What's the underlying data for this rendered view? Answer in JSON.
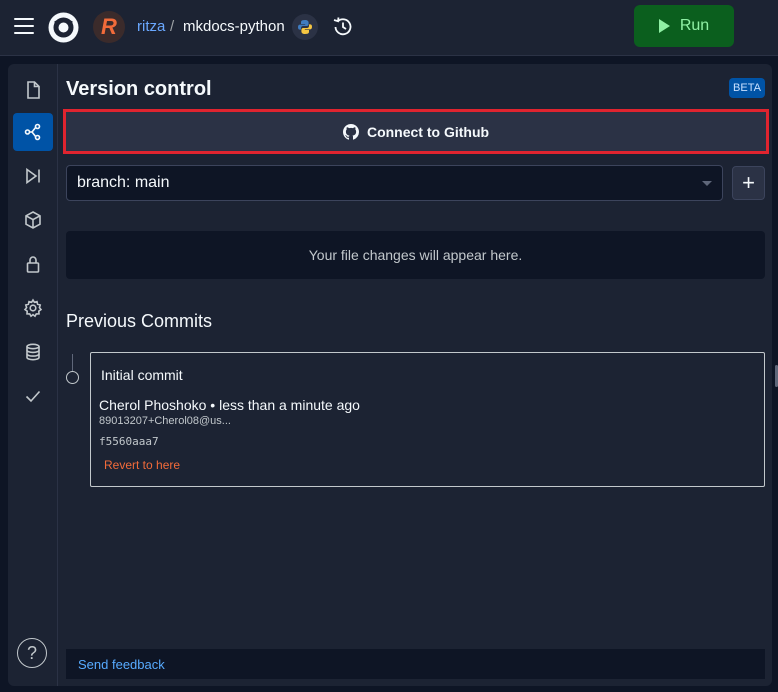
{
  "topbar": {
    "user": "ritza",
    "separator": "/",
    "repl_name": "mkdocs-python",
    "avatar_letter": "R",
    "run_label": "Run",
    "colors": {
      "run_bg": "#0b5f1e",
      "run_text": "#8ff0a4",
      "user_link": "#6aa8ff"
    }
  },
  "sidebar": {
    "items": [
      {
        "icon": "file-icon"
      },
      {
        "icon": "version-control-icon",
        "active": true
      },
      {
        "icon": "debugger-icon"
      },
      {
        "icon": "packages-icon"
      },
      {
        "icon": "secrets-lock-icon"
      },
      {
        "icon": "settings-gear-icon"
      },
      {
        "icon": "database-icon"
      },
      {
        "icon": "checkmark-icon"
      }
    ],
    "help_label": "?"
  },
  "version_control": {
    "title": "Version control",
    "beta": "BETA",
    "connect_label": "Connect to Github",
    "branch_value": "branch: main",
    "add_label": "+",
    "empty_changes": "Your file changes will appear here.",
    "previous_commits_heading": "Previous Commits",
    "commits": [
      {
        "message": "Initial commit",
        "author_line": "Cherol Phoshoko • less than a minute ago",
        "email": "89013207+Cherol08@us...",
        "hash": "f5560aaa7",
        "revert_label": "Revert to here"
      }
    ],
    "feedback_label": "Send feedback",
    "colors": {
      "highlight_border": "#e0242f",
      "revert_link": "#f26b3a",
      "beta_bg": "#0053a6"
    }
  }
}
